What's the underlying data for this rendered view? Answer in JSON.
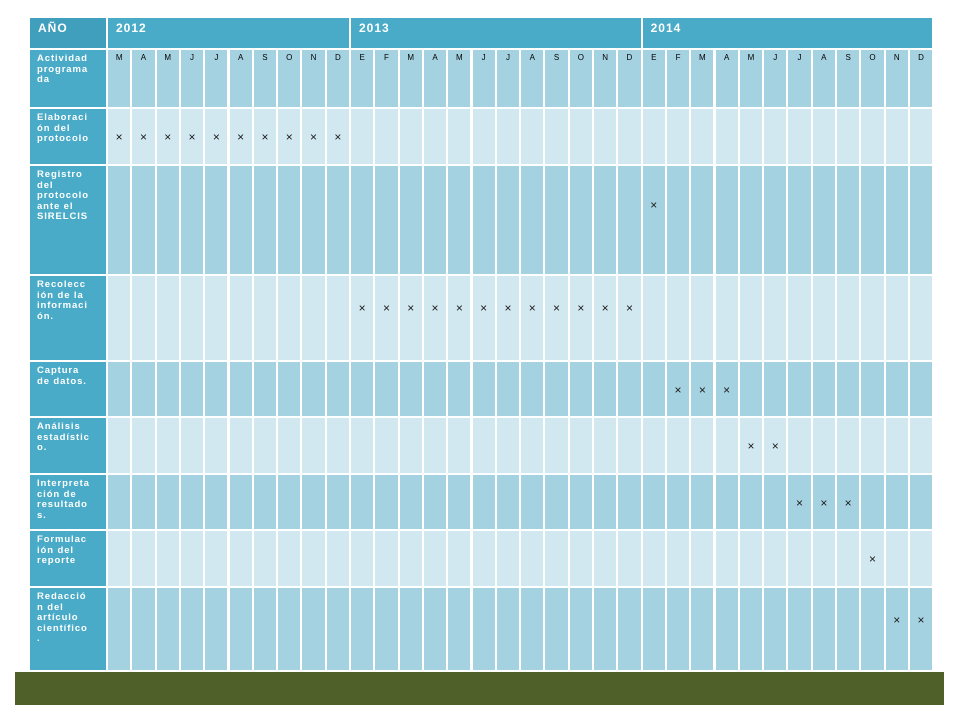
{
  "table": {
    "header_label": "AÑO",
    "years": [
      {
        "label": "2012",
        "months": [
          "M",
          "A",
          "M",
          "J",
          "J",
          "A",
          "S",
          "O",
          "N",
          "D"
        ]
      },
      {
        "label": "2013",
        "months": [
          "E",
          "F",
          "M",
          "A",
          "M",
          "J",
          "J",
          "A",
          "S",
          "O",
          "N",
          "D"
        ]
      },
      {
        "label": "2014",
        "months": [
          "E",
          "F",
          "M",
          "A",
          "M",
          "J",
          "J",
          "A",
          "S",
          "O",
          "N",
          "D"
        ]
      }
    ],
    "activity_header": "Actividad\nprograma\nda",
    "mark_symbol": "×",
    "rows": [
      {
        "activity": "Elaboraci\nón del\nprotocolo",
        "marks": [
          0,
          1,
          2,
          3,
          4,
          5,
          6,
          7,
          8,
          9
        ]
      },
      {
        "activity": "Registro\ndel\nprotocolo\nante el\nSIRELCIS",
        "marks": [
          22
        ]
      },
      {
        "activity": "Recolecc\nión de la\ninformaci\nón.",
        "marks": [
          10,
          11,
          12,
          13,
          14,
          15,
          16,
          17,
          18,
          19,
          20,
          21
        ]
      },
      {
        "activity": "Captura\nde datos.",
        "marks": [
          23,
          24,
          25
        ]
      },
      {
        "activity": "Análisis\nestadístic\no.",
        "marks": [
          26,
          27
        ]
      },
      {
        "activity": "Interpreta\nción de\nresultado\ns.",
        "marks": [
          28,
          29,
          30
        ]
      },
      {
        "activity": "Formulac\nión del\nreporte",
        "marks": [
          31
        ]
      },
      {
        "activity": "Redacció\nn del\nartículo\ncientífico\n.",
        "marks": [
          32,
          33
        ]
      }
    ]
  },
  "colors": {
    "header": "#49abc7",
    "row_dark": "#a5d2e1",
    "row_light": "#d2e8f1",
    "grid": "#ffffff",
    "bottom_band": "#4f6128"
  }
}
